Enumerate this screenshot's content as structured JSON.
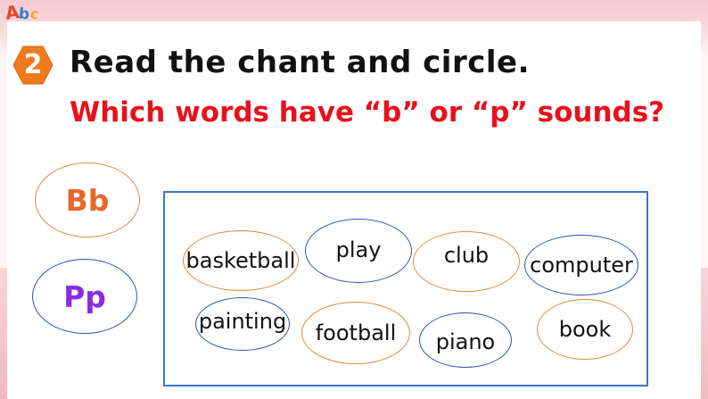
{
  "logo": {
    "a": "A",
    "b": "b",
    "c": "c"
  },
  "step": {
    "number": "2"
  },
  "title": "Read the chant and circle.",
  "subtitle": "Which words have “b” or “p” sounds?",
  "categories": [
    {
      "label": "Bb"
    },
    {
      "label": "Pp"
    }
  ],
  "words": [
    {
      "label": "basketball"
    },
    {
      "label": "play"
    },
    {
      "label": "club"
    },
    {
      "label": "computer"
    },
    {
      "label": "painting"
    },
    {
      "label": "football"
    },
    {
      "label": "piano"
    },
    {
      "label": "book"
    }
  ],
  "colors": {
    "title": "#111111",
    "subtitle": "#e8111b",
    "badge": "#f07b1e",
    "b_circle": "#e08a3a",
    "p_circle": "#2a56b5",
    "box_border": "#3a78c9"
  }
}
